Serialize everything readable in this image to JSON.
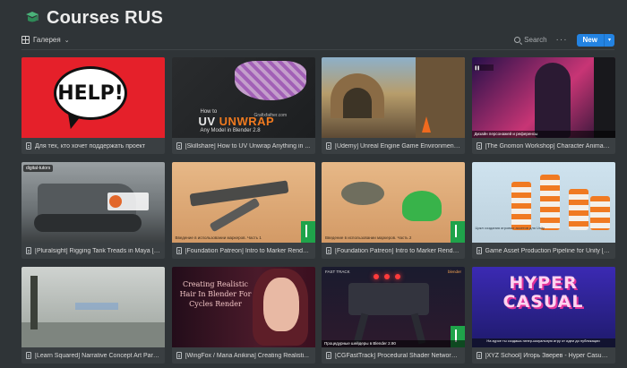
{
  "page": {
    "title": "Courses RUS",
    "icon": "courses-page-icon"
  },
  "toolbar": {
    "view_label": "Галерея",
    "search_label": "Search",
    "more_label": "···",
    "new_label": "New",
    "new_dropdown": "▾"
  },
  "thumbnails": {
    "help_text": "HELP!",
    "uv": {
      "line1": "How to",
      "line2a": "UV ",
      "line2b": "UNWRAP",
      "line3": "Any Model in Blender 2.8",
      "site": "Grafixfather.com"
    },
    "gnomon_side": "Дизайн персонажей и референсы",
    "tank_brand": "digital-tutors",
    "marker1_caption": "Введение в использовании маркеров. Часть 1",
    "marker2_caption": "Введение в использовании маркеров. Часть 2",
    "asset_caption": "Цикл создания игровых ассетов для Unity",
    "wing_title": "Creating Realistic Hair In Blender For Cycles Render",
    "cgfast": {
      "left": "FAST TRACK",
      "right": "blender",
      "strip": "Процедурные шейдеры в Blender 2.90"
    },
    "xyz": {
      "line1": "HYPER",
      "line2": "CASUAL",
      "strip": "На курсе ты создашь гипер-казуальную игру от идеи до публикации"
    }
  },
  "cards": [
    {
      "title": "Для тех, кто хочет поддержать проект"
    },
    {
      "title": "[Skillshare] How to UV Unwrap Anything in ..."
    },
    {
      "title": "[Udemy] Unreal Engine Game Environment ..."
    },
    {
      "title": "[The Gnomon Workshop] Character Animati..."
    },
    {
      "title": "[Pluralsight] Rigging Tank Treads in Maya [E..."
    },
    {
      "title": "[Foundation Patreon] Intro to Marker Rende..."
    },
    {
      "title": "[Foundation Patreon] Intro to Marker Rende..."
    },
    {
      "title": "Game Asset Production Pipeline for Unity [E..."
    },
    {
      "title": "[Learn Squared] Narrative Concept Art Part ..."
    },
    {
      "title": "[WingFox / Maria Anikina] Creating Realisti..."
    },
    {
      "title": "[CGFastTrack] Procedural Shader Networks i..."
    },
    {
      "title": "[XYZ School] Игорь Зверев - Hyper Casual ..."
    }
  ],
  "colors": {
    "background": "#2f3437",
    "card": "#3a3f42",
    "accent": "#2383e2"
  }
}
